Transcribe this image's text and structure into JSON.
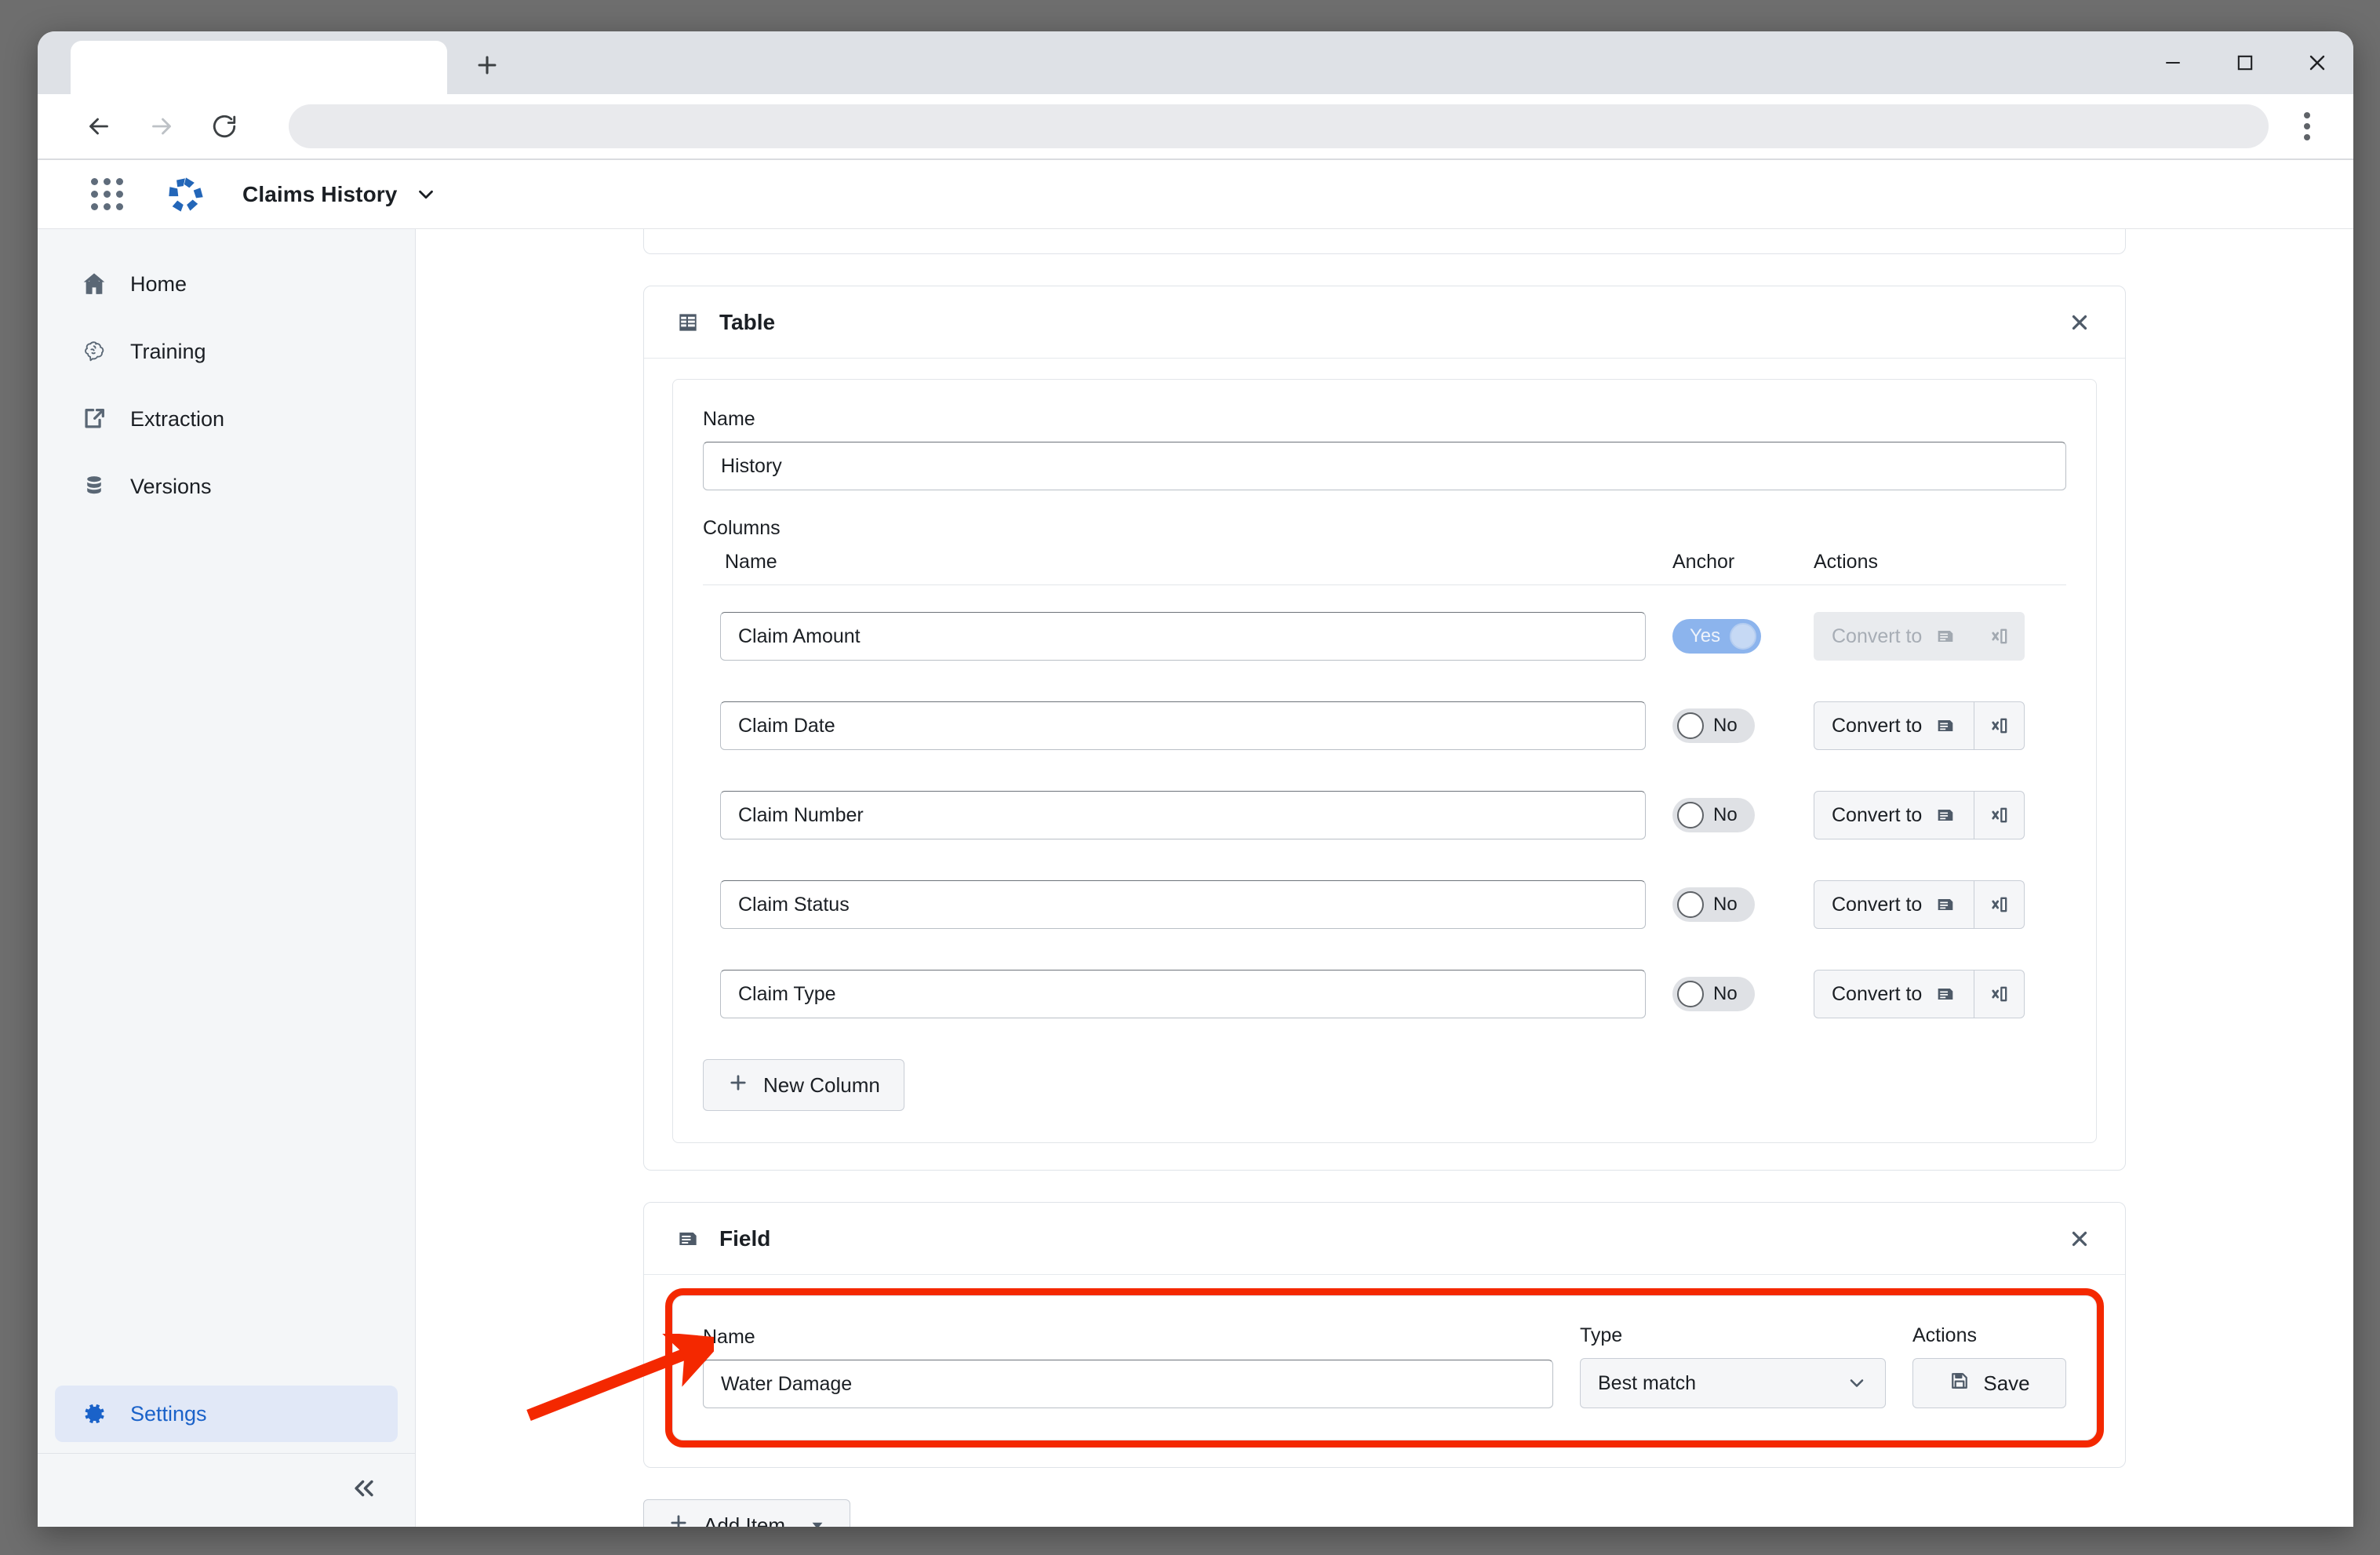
{
  "browser": {
    "tab_title": "",
    "address_value": "",
    "new_tab_label": "+",
    "controls": {
      "minimize": "minimize-icon",
      "maximize": "maximize-icon",
      "close": "close-icon"
    },
    "nav": {
      "back": "back-arrow-icon",
      "forward": "forward-arrow-icon",
      "reload": "reload-icon",
      "menu": "three-dot-menu-icon"
    }
  },
  "app_header": {
    "apps_grid_icon": "apps-grid-icon",
    "logo_icon": "brand-logo-icon",
    "title": "Claims History",
    "caret_icon": "chevron-down-icon"
  },
  "sidebar": {
    "items": [
      {
        "label": "Home",
        "icon": "home-icon",
        "active": false
      },
      {
        "label": "Training",
        "icon": "brain-icon",
        "active": false
      },
      {
        "label": "Extraction",
        "icon": "extract-export-icon",
        "active": false
      },
      {
        "label": "Versions",
        "icon": "database-icon",
        "active": false
      }
    ],
    "settings": {
      "label": "Settings",
      "icon": "gear-icon",
      "active": true
    },
    "collapse_icon": "chevrons-left-icon"
  },
  "table_panel": {
    "icon": "table-icon",
    "title": "Table",
    "close_icon": "close-icon",
    "name_label": "Name",
    "name_value": "History",
    "columns_label": "Columns",
    "headers": {
      "name": "Name",
      "anchor": "Anchor",
      "actions": "Actions"
    },
    "convert_label": "Convert to",
    "convert_icon": "document-icon",
    "delete_icon": "delete-column-icon",
    "rows": [
      {
        "name": "Claim Amount",
        "anchor": "Yes",
        "anchor_on": true,
        "actions_disabled": true
      },
      {
        "name": "Claim Date",
        "anchor": "No",
        "anchor_on": false,
        "actions_disabled": false
      },
      {
        "name": "Claim Number",
        "anchor": "No",
        "anchor_on": false,
        "actions_disabled": false
      },
      {
        "name": "Claim Status",
        "anchor": "No",
        "anchor_on": false,
        "actions_disabled": false
      },
      {
        "name": "Claim Type",
        "anchor": "No",
        "anchor_on": false,
        "actions_disabled": false
      }
    ],
    "new_column_label": "New Column",
    "new_column_icon": "plus-icon"
  },
  "field_panel": {
    "icon": "field-document-icon",
    "title": "Field",
    "close_icon": "close-icon",
    "name_label": "Name",
    "name_value": "Water Damage",
    "name_placeholder": "Name",
    "type_label": "Type",
    "type_value": "Best match",
    "type_caret_icon": "chevron-down-icon",
    "actions_label": "Actions",
    "save_label": "Save",
    "save_icon": "floppy-save-icon",
    "highlight_color": "#f42800"
  },
  "footer": {
    "add_item_label": "Add Item",
    "add_item_icon": "plus-icon",
    "add_item_caret_icon": "caret-down-icon"
  },
  "annotation": {
    "arrow_color": "#f42800",
    "arrow_name": "red-pointer-arrow"
  },
  "colors": {
    "accent_blue": "#1a62c9",
    "toggle_on": "#8cb4ed",
    "highlight_red": "#f42800"
  }
}
